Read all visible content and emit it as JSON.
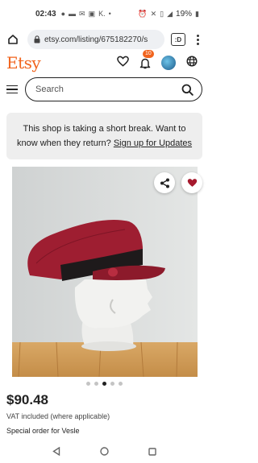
{
  "status_bar": {
    "time": "02:43",
    "battery": "19%",
    "notification_icons": [
      "chat-icon",
      "message-icon",
      "mail-icon",
      "photo-icon",
      "k-app-icon"
    ],
    "system_icons": [
      "alarm-icon",
      "mute-icon",
      "vibrate-icon",
      "signal-icon",
      "battery-icon"
    ]
  },
  "browser": {
    "url": "etsy.com/listing/675182270/s",
    "tabs_icon_label": ":D"
  },
  "header": {
    "logo": "Etsy",
    "notification_count": "10"
  },
  "search": {
    "placeholder": "Search"
  },
  "notice": {
    "message": "This shop is taking a short break. Want to know when they return? ",
    "link": "Sign up for Updates"
  },
  "product": {
    "price": "$90.48",
    "vat_note": "VAT included (where applicable)",
    "special_order": "Special order for Vesle",
    "image_count": 5,
    "active_image_index": 2
  },
  "colors": {
    "brand": "#f1641e",
    "favorite": "#a61a2e",
    "hat": "#9e1e31"
  }
}
